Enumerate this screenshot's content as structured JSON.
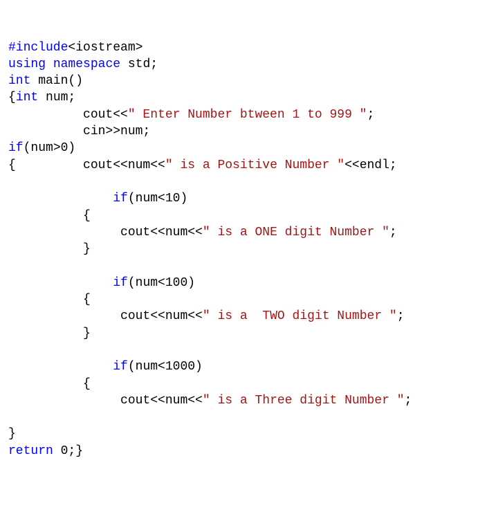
{
  "lines": {
    "l1_a": "#include",
    "l1_b": "<iostream>",
    "l2_a": "using",
    "l2_b": " ",
    "l2_c": "namespace",
    "l2_d": " std;",
    "l3_a": "int",
    "l3_b": " main()",
    "l4_a": "{",
    "l4_b": "int",
    "l4_c": " num;",
    "l5_a": "          cout<<",
    "l5_b": "\" Enter Number btween 1 to 999 \"",
    "l5_c": ";",
    "l6_a": "          cin>>num;",
    "l7_a": "if",
    "l7_b": "(num>0)",
    "l8_a": "{         cout<<num<<",
    "l8_b": "\" is a Positive Number \"",
    "l8_c": "<<endl;",
    "l9": "",
    "l10_a": "              ",
    "l10_b": "if",
    "l10_c": "(num<10)",
    "l11": "          {",
    "l12_a": "               cout<<num<<",
    "l12_b": "\" is a ONE digit Number \"",
    "l12_c": ";",
    "l13": "          }",
    "l14": "",
    "l15_a": "              ",
    "l15_b": "if",
    "l15_c": "(num<100)",
    "l16": "          {",
    "l17_a": "               cout<<num<<",
    "l17_b": "\" is a  TWO digit Number \"",
    "l17_c": ";",
    "l18": "          }",
    "l19": "",
    "l20_a": "              ",
    "l20_b": "if",
    "l20_c": "(num<1000)",
    "l21": "          {",
    "l22_a": "               cout<<num<<",
    "l22_b": "\" is a Three digit Number \"",
    "l22_c": ";",
    "l23": "",
    "l24": "}",
    "l25_a": "return",
    "l25_b": " 0;}"
  }
}
